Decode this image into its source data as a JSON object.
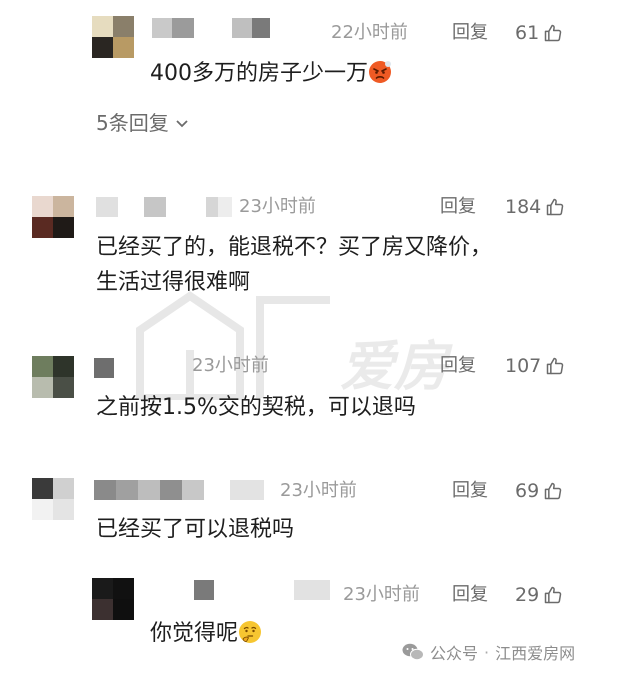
{
  "comments": [
    {
      "time": "22小时前",
      "reply": "回复",
      "likes": "61",
      "text": "400多万的房子少一万",
      "emoji": "angry-face",
      "more_replies": "5条回复"
    },
    {
      "time": "23小时前",
      "reply": "回复",
      "likes": "184",
      "text_line1": "已经买了的，能退税不？买了房又降价，",
      "text_line2": "生活过得很难啊"
    },
    {
      "time": "23小时前",
      "reply": "回复",
      "likes": "107",
      "text": "之前按1.5%交的契税，可以退吗"
    },
    {
      "time": "23小时前",
      "reply": "回复",
      "likes": "69",
      "text": "已经买了可以退税吗"
    },
    {
      "time": "23小时前",
      "reply": "回复",
      "likes": "29",
      "text": "你觉得呢",
      "emoji": "thinking-face"
    }
  ],
  "watermark": {
    "text": "爱房"
  },
  "footer": {
    "platform": "公众号",
    "separator": "·",
    "account": "江西爱房网"
  },
  "colors": {
    "text": "#1e1e1e",
    "meta": "#9a9a9a",
    "action": "#6b6b6b"
  }
}
